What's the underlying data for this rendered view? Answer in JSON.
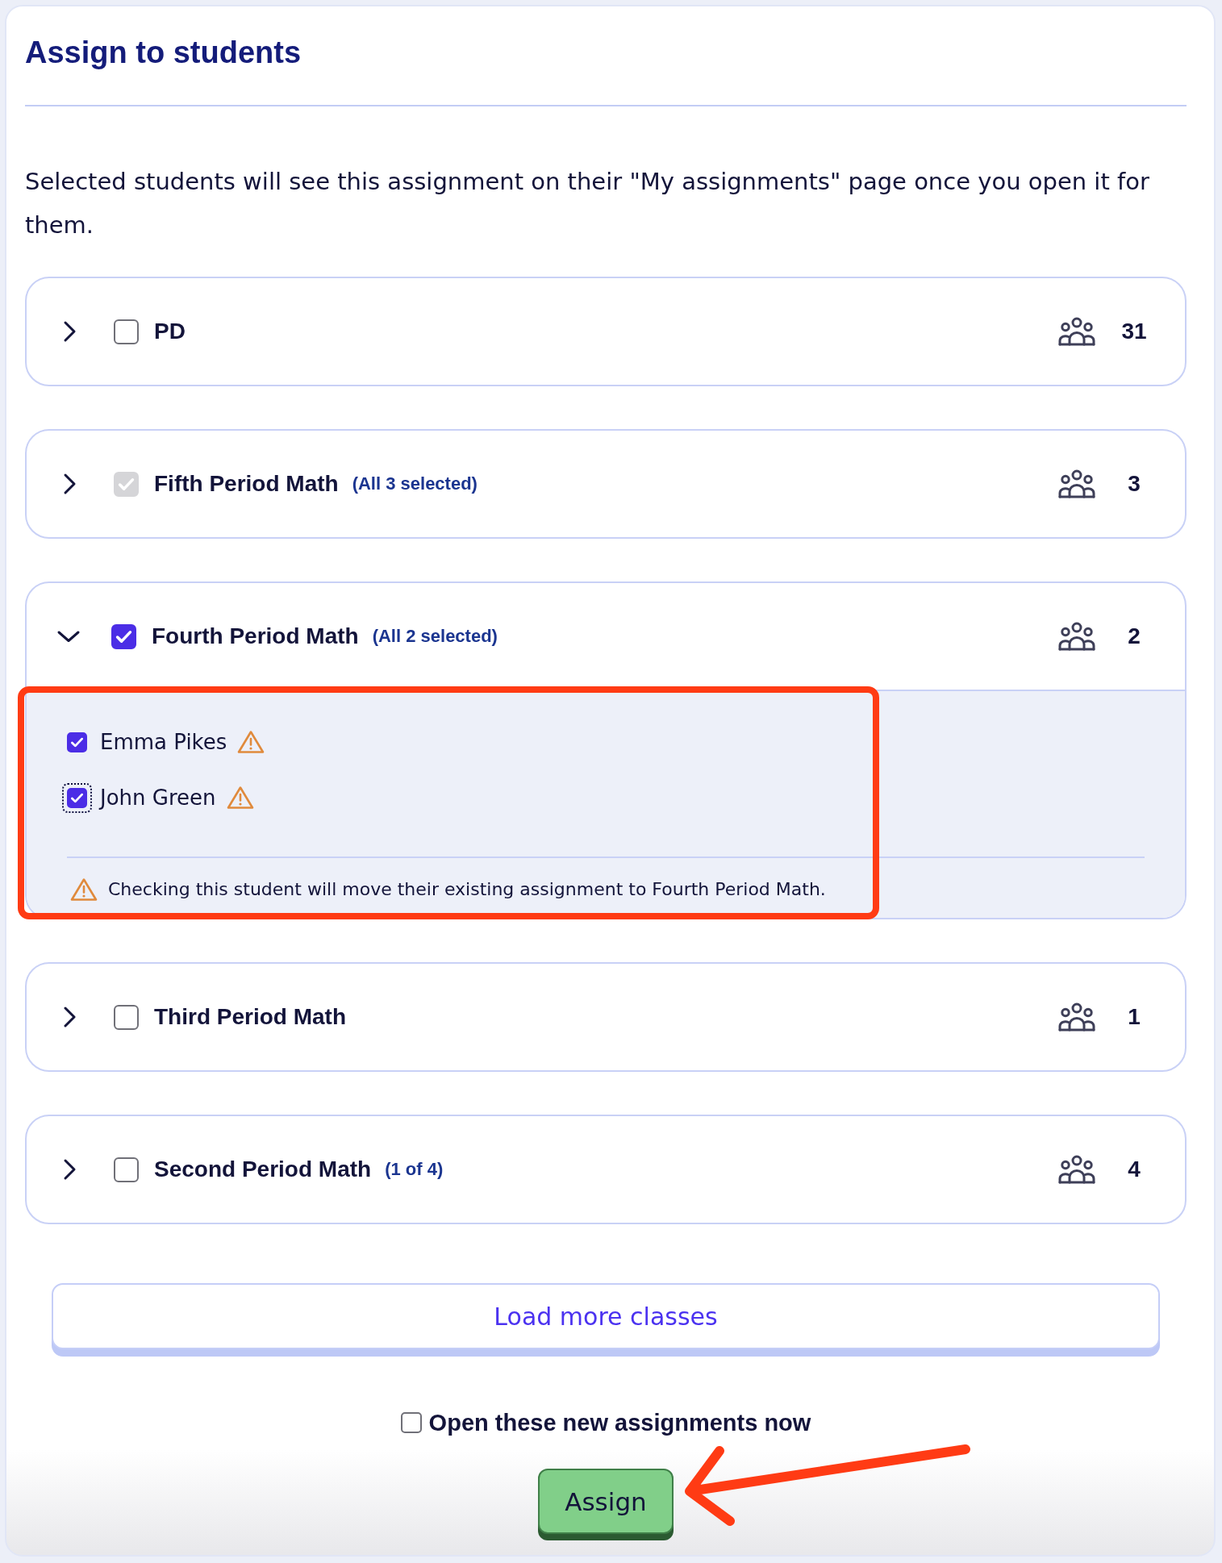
{
  "dialog": {
    "title": "Assign to students",
    "description": "Selected students will see this assignment on their \"My assignments\" page once you open it for them."
  },
  "classes": [
    {
      "name": "PD",
      "checked": false,
      "disabled": false,
      "expanded": false,
      "count": "31"
    },
    {
      "name": "Fifth Period Math",
      "summary": "(All 3 selected)",
      "checked": true,
      "disabled": true,
      "expanded": false,
      "count": "3"
    },
    {
      "name": "Fourth Period Math",
      "summary": "(All 2 selected)",
      "checked": true,
      "disabled": false,
      "expanded": true,
      "annotation": {
        "kind": "frame"
      },
      "count": "2",
      "students": [
        {
          "name": "Emma Pikes",
          "checked": true,
          "focused": false,
          "warning": true
        },
        {
          "name": "John Green",
          "checked": true,
          "focused": true,
          "warning": true
        }
      ],
      "warning_note": "Checking this student will move their existing assignment to Fourth Period Math."
    },
    {
      "name": "Third Period Math",
      "checked": false,
      "disabled": false,
      "expanded": false,
      "count": "1"
    },
    {
      "name": "Second Period Math",
      "summary": "(1 of 4)",
      "checked": false,
      "disabled": false,
      "expanded": false,
      "count": "4"
    }
  ],
  "load_more": "Load more classes",
  "open_now": {
    "label": "Open these new assignments now",
    "checked": false
  },
  "assign_button": {
    "label": "Assign",
    "annotation": {
      "kind": "arrow"
    }
  }
}
